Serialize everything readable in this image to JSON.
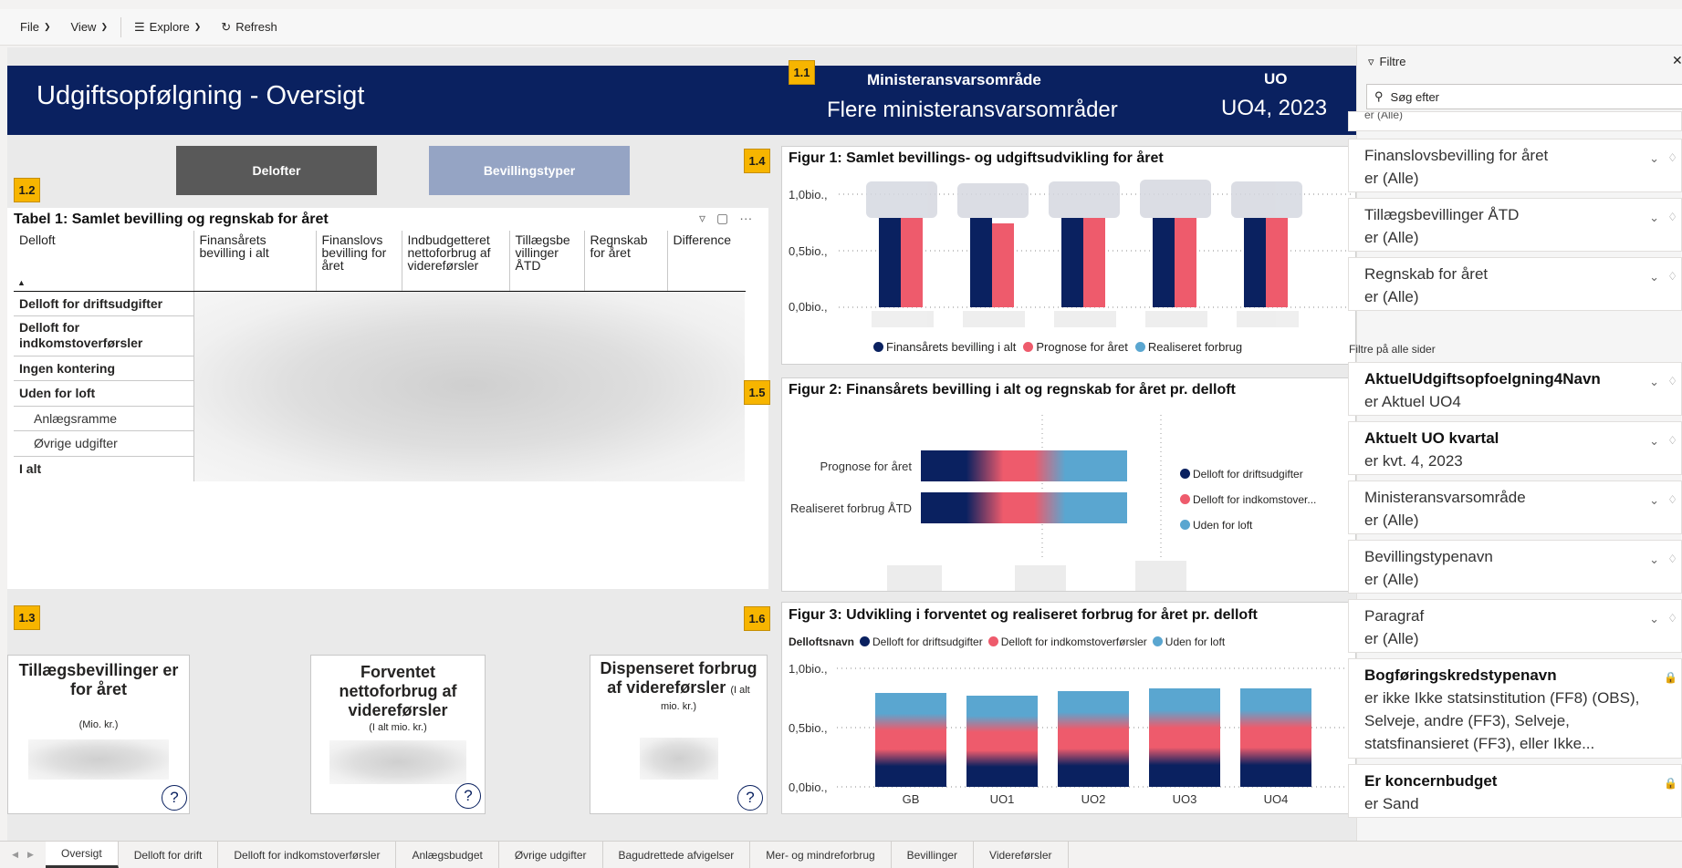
{
  "toolbar": {
    "file": "File",
    "view": "View",
    "explore": "Explore",
    "refresh": "Refresh"
  },
  "header": {
    "title": "Udgiftsopfølgning - Oversigt",
    "badge": "1.1",
    "min_label": "Ministeransvarsområde",
    "min_value": "Flere ministeransvarsområder",
    "uo_label": "UO",
    "uo_value": "UO4, 2023"
  },
  "toggles": {
    "delofter": "Delofter",
    "bevillingstyper": "Bevillingstyper"
  },
  "table1": {
    "badge": "1.2",
    "title": "Tabel 1: Samlet bevilling og regnskab for året",
    "columns": [
      "Delloft",
      "Finansårets bevilling i alt",
      "Finanslovs bevilling for året",
      "Indbudgetteret nettoforbrug af videreførsler",
      "Tillægsbe villinger ÅTD",
      "Regnskab for året",
      "Difference"
    ],
    "rows": [
      {
        "label": "Delloft for driftsudgifter",
        "sub": false
      },
      {
        "label": "Delloft for indkomstoverførsler",
        "sub": false
      },
      {
        "label": "Ingen kontering",
        "sub": false
      },
      {
        "label": "Uden for loft",
        "sub": false
      },
      {
        "label": "Anlægsramme",
        "sub": true
      },
      {
        "label": "Øvrige udgifter",
        "sub": true
      },
      {
        "label": "I alt",
        "sub": false
      }
    ]
  },
  "kpis": {
    "badge": "1.3",
    "tillaeg_title": "Tillægsbevillinger er for året",
    "tillaeg_sub": "(Mio. kr.)",
    "forventet_title": "Forventet nettoforbrug af videreførsler",
    "forventet_sub": "(I alt mio. kr.)",
    "disp_title": "Dispenseret forbrug af videreførsler",
    "disp_inline": "(I alt",
    "disp_sub": "mio. kr.)",
    "help": "?"
  },
  "fig1": {
    "badge": "1.4",
    "title": "Figur 1: Samlet bevillings- og udgiftsudvikling for året",
    "legend": [
      "Finansårets bevilling i alt",
      "Prognose for året",
      "Realiseret forbrug"
    ],
    "colors": [
      "#0a2160",
      "#ee5b6c",
      "#5aa6d0"
    ],
    "ticks": [
      "1,0bio.,",
      "0,5bio.,",
      "0,0bio.,"
    ]
  },
  "fig2": {
    "badge": "1.5",
    "title": "Figur 2: Finansårets bevilling i alt og regnskab for året pr. delloft",
    "categories": [
      "Prognose for året",
      "Realiseret forbrug ÅTD"
    ],
    "legend": [
      "Delloft for driftsudgifter",
      "Delloft for indkomstover..."
    ],
    "legend3": "Uden for loft"
  },
  "fig3": {
    "badge": "1.6",
    "title": "Figur 3: Udvikling i forventet og realiseret forbrug for året pr. delloft",
    "legend_title": "Delloftsnavn",
    "legend": [
      "Delloft for driftsudgifter",
      "Delloft for indkomstoverførsler",
      "Uden for loft"
    ],
    "ticks": [
      "1,0bio.,",
      "0,5bio.,",
      "0,0bio.,"
    ],
    "categories": [
      "GB",
      "UO1",
      "UO2",
      "UO3",
      "UO4"
    ]
  },
  "filters": {
    "title": "Filtre",
    "search_placeholder": "Søg efter",
    "truncated_top": "er (Alle)",
    "visual_cards": [
      {
        "name": "Finanslovsbevilling for året",
        "value": "er (Alle)"
      },
      {
        "name": "Tillægsbevillinger ÅTD",
        "value": "er (Alle)"
      },
      {
        "name": "Regnskab for året",
        "value": "er (Alle)"
      }
    ],
    "all_pages_label": "Filtre på alle sider",
    "page_cards": [
      {
        "name": "AktuelUdgiftsopfoelgning4Navn",
        "value": "er Aktuel UO4",
        "bold": true
      },
      {
        "name": "Aktuelt UO kvartal",
        "value": "er kvt. 4, 2023",
        "bold": true
      },
      {
        "name": "Ministeransvarsområde",
        "value": "er (Alle)",
        "bold": false
      },
      {
        "name": "Bevillingstypenavn",
        "value": "er (Alle)",
        "bold": false
      },
      {
        "name": "Paragraf",
        "value": "er (Alle)",
        "bold": false
      }
    ],
    "locked_cards": [
      {
        "name": "Bogføringskredstypenavn",
        "value": "er ikke Ikke statsinstitution (FF8) (OBS), Selveje, andre (FF3), Selveje, statsfinansieret (FF3), eller Ikke..."
      },
      {
        "name": "Er koncernbudget",
        "value": "er Sand"
      }
    ]
  },
  "tabs": [
    "Oversigt",
    "Delloft for drift",
    "Delloft for indkomstoverførsler",
    "Anlægsbudget",
    "Øvrige udgifter",
    "Bagudrettede afvigelser",
    "Mer- og mindreforbrug",
    "Bevillinger",
    "Videreførsler"
  ]
}
